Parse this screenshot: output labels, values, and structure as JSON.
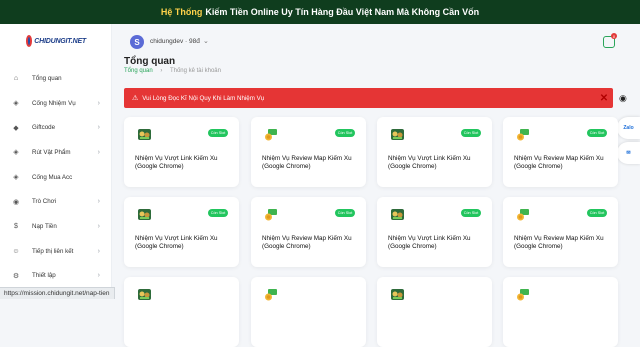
{
  "banner": {
    "accent": "Hệ Thống",
    "rest": "Kiếm Tiền Online Uy Tín Hàng Đầu Việt Nam Mà Không Cần Vốn"
  },
  "logo": {
    "text": "CHIDUNGIT.NET"
  },
  "sidebar": {
    "items": [
      {
        "label": "Tổng quan",
        "icon": "home-icon",
        "glyph": "⌂",
        "chevron": false
      },
      {
        "label": "Cống Nhiệm Vụ",
        "icon": "box-icon",
        "glyph": "◈",
        "chevron": true
      },
      {
        "label": "Giftcode",
        "icon": "gift-icon",
        "glyph": "◆",
        "chevron": true
      },
      {
        "label": "Rút Vật Phẩm",
        "icon": "box-icon",
        "glyph": "◈",
        "chevron": true
      },
      {
        "label": "Cống Mua Acc",
        "icon": "box-icon",
        "glyph": "◈",
        "chevron": false
      },
      {
        "label": "Trò Chơi",
        "icon": "gamepad-icon",
        "glyph": "◉",
        "chevron": true
      },
      {
        "label": "Nạp Tiền",
        "icon": "dollar-icon",
        "glyph": "$",
        "chevron": true
      },
      {
        "label": "Tiếp thị liên kết",
        "icon": "users-icon",
        "glyph": "☺",
        "chevron": true
      },
      {
        "label": "Thiết lập",
        "icon": "settings-icon",
        "glyph": "⚙",
        "chevron": true
      }
    ]
  },
  "header": {
    "avatar_letter": "S",
    "username": "chidungdev · 98đ",
    "notification_count": "0"
  },
  "page": {
    "title": "Tổng quan",
    "breadcrumb_home": "Tổng quan",
    "breadcrumb_current": "Thống kê tài khoản"
  },
  "alert": {
    "text": "Vui Lòng Đọc Kĩ Nội Quy Khi Làm Nhiệm Vụ"
  },
  "side_widget": {
    "label": "Zalo"
  },
  "cards": [
    {
      "title": "Nhiệm Vụ Vượt Link Kiếm Xu (Google Chrome)",
      "status": "Còn Slot",
      "thumb": "game-thumb-icon"
    },
    {
      "title": "Nhiệm Vụ Review Map Kiếm Xu (Google Chrome)",
      "status": "Còn Slot",
      "thumb": "money-hand-icon"
    },
    {
      "title": "Nhiệm Vụ Vượt Link Kiếm Xu (Google Chrome)",
      "status": "Còn Slot",
      "thumb": "game-thumb-icon"
    },
    {
      "title": "Nhiệm Vụ Review Map Kiếm Xu (Google Chrome)",
      "status": "Còn Slot",
      "thumb": "money-hand-icon"
    },
    {
      "title": "Nhiệm Vụ Vượt Link Kiếm Xu (Google Chrome)",
      "status": "Còn Slot",
      "thumb": "game-thumb-icon"
    },
    {
      "title": "Nhiệm Vụ Review Map Kiếm Xu (Google Chrome)",
      "status": "Còn Slot",
      "thumb": "money-hand-icon"
    },
    {
      "title": "Nhiệm Vụ Vượt Link Kiếm Xu (Google Chrome)",
      "status": "Còn Slot",
      "thumb": "game-thumb-icon"
    },
    {
      "title": "Nhiệm Vụ Review Map Kiếm Xu (Google Chrome)",
      "status": "Còn Slot",
      "thumb": "money-hand-icon"
    },
    {
      "title": "",
      "status": "",
      "thumb": "game-thumb-icon"
    },
    {
      "title": "",
      "status": "",
      "thumb": "money-hand-icon"
    },
    {
      "title": "",
      "status": "",
      "thumb": "game-thumb-icon"
    },
    {
      "title": "",
      "status": "",
      "thumb": "money-hand-icon"
    }
  ],
  "status_bar": {
    "url": "https://mission.chidungit.net/nap-tien"
  },
  "colors": {
    "banner_bg": "#0f3d1e",
    "accent_yellow": "#ffd24a",
    "alert_red": "#e53535",
    "status_green": "#22c55e"
  }
}
